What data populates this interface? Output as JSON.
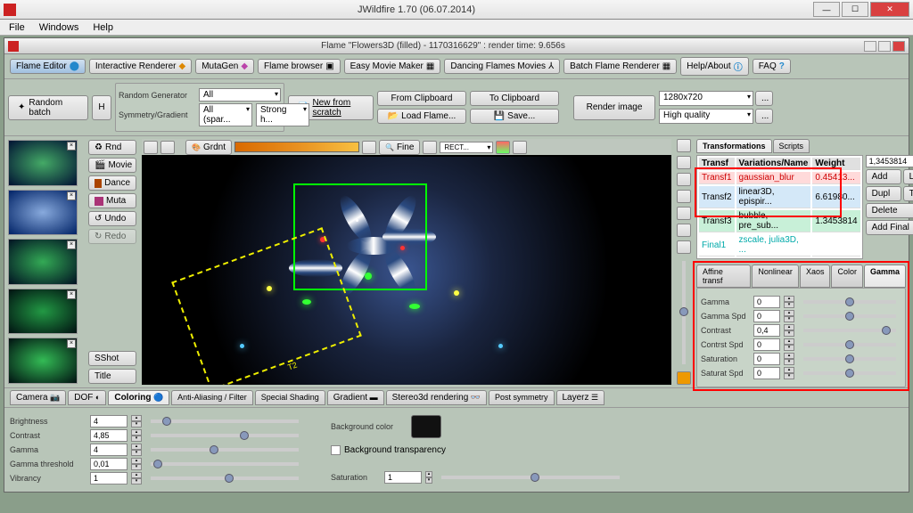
{
  "window": {
    "title": "JWildfire 1.70 (06.07.2014)"
  },
  "menu": {
    "file": "File",
    "windows": "Windows",
    "help": "Help"
  },
  "sub": {
    "title": "Flame \"Flowers3D (filled) - 1170316629\" : render time: 9.656s"
  },
  "tb": {
    "flame_editor": "Flame Editor",
    "interactive": "Interactive Renderer",
    "mutagen": "MutaGen",
    "browser": "Flame browser",
    "movie": "Easy Movie Maker",
    "dancing": "Dancing Flames Movies",
    "batch": "Batch Flame Renderer",
    "help": "Help/About",
    "faq": "FAQ"
  },
  "top": {
    "random_batch": "Random batch",
    "h": "H",
    "rnd_gen": "Random Generator",
    "rnd_all": "All",
    "sym_grad": "Symmetry/Gradient",
    "sym_all": "All (spar...",
    "strong": "Strong h...",
    "new": "New from scratch",
    "from_clip": "From Clipboard",
    "to_clip": "To Clipboard",
    "load": "Load Flame...",
    "save": "Save...",
    "render": "Render image",
    "res": "1280x720",
    "dots": "...",
    "quality": "High quality"
  },
  "btncol": {
    "rnd": "Rnd",
    "movie": "Movie",
    "dance": "Dance",
    "muta": "Muta",
    "undo": "Undo",
    "redo": "Redo",
    "sshot": "SShot",
    "title": "Title"
  },
  "rtb": {
    "grdnt": "Grdnt",
    "fine": "Fine",
    "rect": "RECT..."
  },
  "canvas": {
    "t2": "T2"
  },
  "tabs": {
    "transforms": "Transformations",
    "scripts": "Scripts"
  },
  "table": {
    "h1": "Transf",
    "h2": "Variations/Name",
    "h3": "Weight",
    "r1a": "Transf1",
    "r1b": "gaussian_blur",
    "r1c": "0.45413...",
    "r2a": "Transf2",
    "r2b": "linear3D, epispir...",
    "r2c": "6.61980...",
    "r3a": "Transf3",
    "r3b": "bubble, pre_sub...",
    "r3c": "1.3453814",
    "r4a": "Final1",
    "r4b": "zscale, julia3D, ...",
    "r4c": ""
  },
  "rbtn": {
    "add": "Add",
    "l": "L",
    "dupl": "Dupl",
    "t": "T",
    "del": "Delete",
    "addfinal": "Add Final"
  },
  "wval": "1,3453814",
  "ptabs": {
    "affine": "Affine transf",
    "nonlinear": "Nonlinear",
    "xaos": "Xaos",
    "color": "Color",
    "gamma": "Gamma"
  },
  "gp": {
    "gamma": "Gamma",
    "gamma_v": "0",
    "gammaspd": "Gamma Spd",
    "gammaspd_v": "0",
    "contrast": "Contrast",
    "contrast_v": "0,4",
    "contrstspd": "Contrst Spd",
    "contrstspd_v": "0",
    "sat": "Saturation",
    "sat_v": "0",
    "satspd": "Saturat Spd",
    "satspd_v": "0"
  },
  "btabs": {
    "camera": "Camera",
    "dof": "DOF",
    "coloring": "Coloring",
    "aa": "Anti-Aliasing / Filter",
    "shading": "Special Shading",
    "gradient": "Gradient",
    "stereo": "Stereo3d rendering",
    "post": "Post symmetry",
    "layerz": "Layerz"
  },
  "bp": {
    "brightness": "Brightness",
    "brightness_v": "4",
    "contrast": "Contrast",
    "contrast_v": "4,85",
    "gamma": "Gamma",
    "gamma_v": "4",
    "gt": "Gamma threshold",
    "gt_v": "0,01",
    "vibrancy": "Vibrancy",
    "vibrancy_v": "1",
    "bgcolor": "Background color",
    "bgtrans": "Background transparency",
    "sat": "Saturation",
    "sat_v": "1"
  }
}
